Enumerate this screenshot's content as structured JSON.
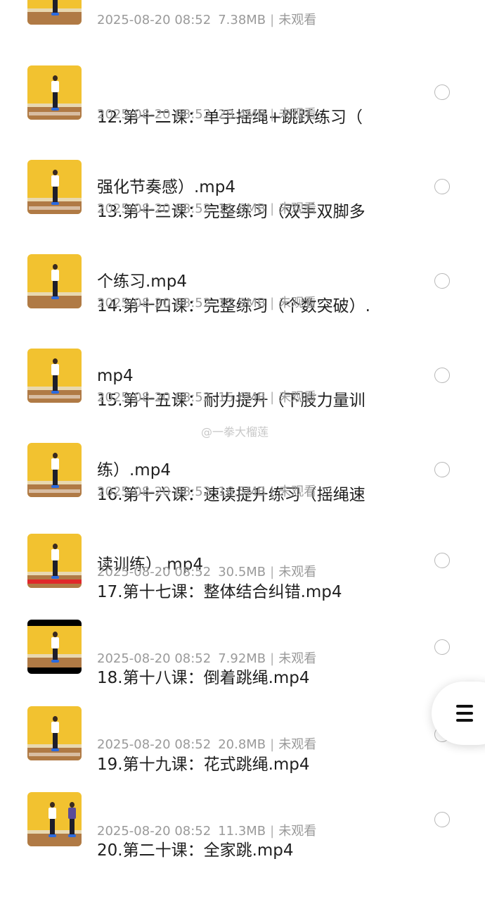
{
  "items": [
    {
      "title": "",
      "date": "2025-08-20 08:52",
      "size": "7.38MB",
      "status": "未观看"
    },
    {
      "title": "12.第十二课：单手摇绳+跳跃练习（强化节奏感）.mp4",
      "line1": "12.第十二课：单手摇绳+跳跃练习（",
      "line2": "强化节奏感）.mp4",
      "date": "2025-08-20 08:52",
      "size": "28.4MB",
      "status": "未观看"
    },
    {
      "title": "13.第十三课：完整练习（双手双脚多个练习.mp4",
      "line1": "13.第十三课：完整练习（双手双脚多",
      "line2": "个练习.mp4",
      "date": "2025-08-20 08:52",
      "size": "11.8MB",
      "status": "未观看"
    },
    {
      "title": "14.第十四课：完整练习（个数突破）.mp4",
      "line1": "14.第十四课：完整练习（个数突破）.",
      "line2": "mp4",
      "date": "2025-08-20 08:52",
      "size": "17.9MB",
      "status": "未观看"
    },
    {
      "title": "15.第十五课：耐力提升（下肢力量训练）.mp4",
      "line1": "15.第十五课：耐力提升（下肢力量训",
      "line2": "练）.mp4",
      "date": "2025-08-20 08:52",
      "size": "15.6MB",
      "status": "未观看"
    },
    {
      "title": "16.第十六课：速读提升练习（摇绳速读训练）.mp4",
      "line1": "16.第十六课：速读提升练习（摇绳速",
      "line2": "读训练）.mp4",
      "date": "2025-08-20 08:52",
      "size": "16.5MB",
      "status": "未观看"
    },
    {
      "title": "17.第十七课：整体结合纠错.mp4",
      "line1": "17.第十七课：整体结合纠错.mp4",
      "line2": "",
      "date": "2025-08-20 08:52",
      "size": "30.5MB",
      "status": "未观看"
    },
    {
      "title": "18.第十八课：倒着跳绳.mp4",
      "line1": "18.第十八课：倒着跳绳.mp4",
      "line2": "",
      "date": "2025-08-20 08:52",
      "size": "7.92MB",
      "status": "未观看"
    },
    {
      "title": "19.第十九课：花式跳绳.mp4",
      "line1": "19.第十九课：花式跳绳.mp4",
      "line2": "",
      "date": "2025-08-20 08:52",
      "size": "20.8MB",
      "status": "未观看"
    },
    {
      "title": "20.第二十课：全家跳.mp4",
      "line1": "20.第二十课：全家跳.mp4",
      "line2": "",
      "date": "2025-08-20 08:52",
      "size": "11.3MB",
      "status": "未观看"
    }
  ],
  "watermark": "@一拳大榴莲",
  "menu_icon": "hamburger-menu-icon",
  "colors": {
    "thumb_wall": "#f2c230",
    "thumb_floor": "#b07a45",
    "meta_text": "#9a9a9a"
  }
}
